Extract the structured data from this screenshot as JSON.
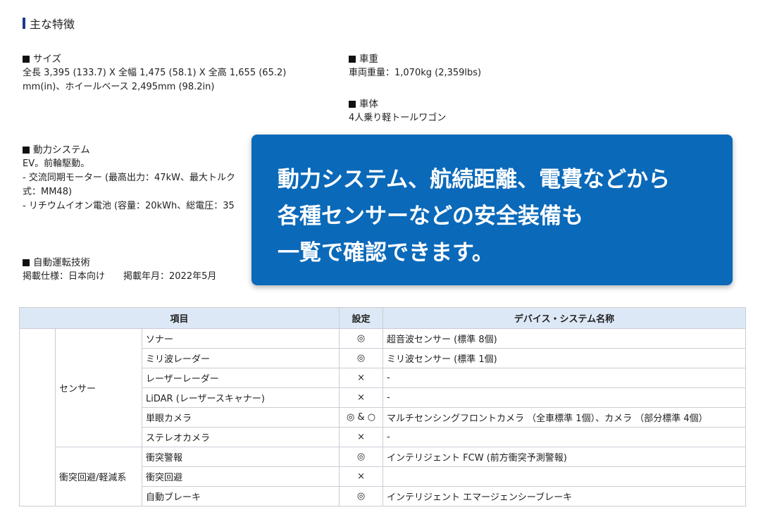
{
  "heading": "主な特徴",
  "specs": {
    "size": {
      "title": "サイズ",
      "body": "全長 3,395 (133.7) X 全幅 1,475 (58.1) X 全高 1,655 (65.2)\nmm(in)、ホイールベース 2,495mm (98.2in)"
    },
    "weight": {
      "title": "車重",
      "body": "車両重量：1,070kg (2,359lbs)"
    },
    "body_type": {
      "title": "車体",
      "body": "4人乗り軽トールワゴン"
    },
    "power": {
      "title": "動力システム",
      "body": "EV。前輪駆動。\n- 交流同期モーター (最高出力：47kW、最大トルク\n式：MM48)\n- リチウムイオン電池 (容量：20kWh、総電圧：35"
    },
    "auto": {
      "title": "自動運転技術",
      "body": "掲載仕様：日本向け　　掲載年月：2022年5月"
    }
  },
  "callout": {
    "line1": "動力システム、航続距離、電費などから",
    "line2": "各種センサーなどの安全装備も",
    "line3": "一覧で確認できます。"
  },
  "table": {
    "headers": {
      "item": "項目",
      "setting": "設定",
      "device": "デバイス・システム名称"
    },
    "groups": {
      "sensor": "センサー",
      "collision": "衝突回避/軽減系"
    },
    "rows": [
      {
        "item": "ソナー",
        "setting": "◎",
        "device": "超音波センサー (標準 8個)"
      },
      {
        "item": "ミリ波レーダー",
        "setting": "◎",
        "device": "ミリ波センサー (標準 1個)"
      },
      {
        "item": "レーザーレーダー",
        "setting": "×",
        "device": "-"
      },
      {
        "item": "LiDAR (レーザースキャナー)",
        "setting": "×",
        "device": "-"
      },
      {
        "item": "単眼カメラ",
        "setting": "◎ & ○",
        "device": "マルチセンシングフロントカメラ （全車標準 1個）、カメラ （部分標準 4個）"
      },
      {
        "item": "ステレオカメラ",
        "setting": "×",
        "device": "-"
      },
      {
        "item": "衝突警報",
        "setting": "◎",
        "device": "インテリジェント FCW (前方衝突予測警報)"
      },
      {
        "item": "衝突回避",
        "setting": "×",
        "device": ""
      },
      {
        "item": "自動ブレーキ",
        "setting": "◎",
        "device": "インテリジェント エマージェンシーブレーキ"
      }
    ]
  }
}
